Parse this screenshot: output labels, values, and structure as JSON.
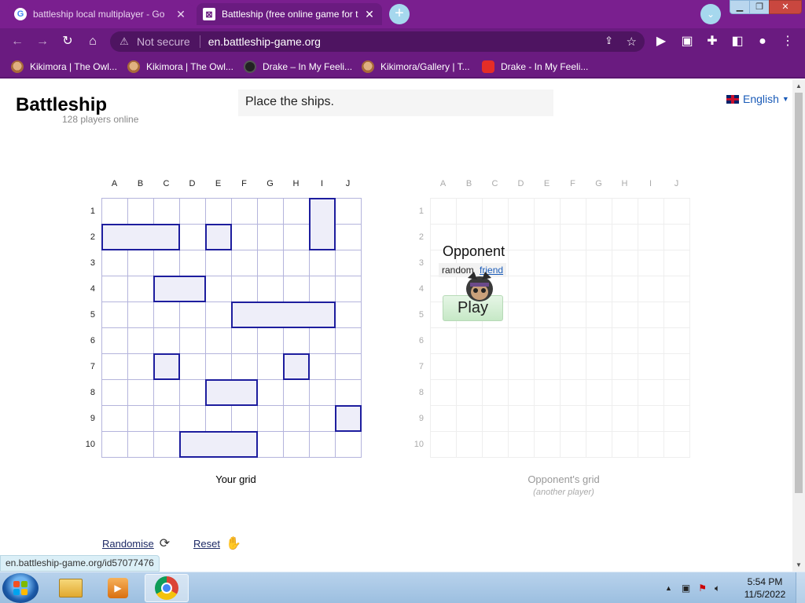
{
  "browser": {
    "tabs": [
      {
        "title": "battleship local multiplayer - Go",
        "favicon": "google-icon",
        "active": false
      },
      {
        "title": "Battleship (free online game for t",
        "favicon": "battleship-icon",
        "active": true
      }
    ],
    "new_tab_symbol": "+",
    "address": {
      "security_text": "Not secure",
      "url": "en.battleship-game.org"
    },
    "bookmarks": [
      {
        "label": "Kikimora | The Owl...",
        "icon": "owl-icon"
      },
      {
        "label": "Kikimora | The Owl...",
        "icon": "owl-icon"
      },
      {
        "label": "Drake – In My Feeli...",
        "icon": "music-icon"
      },
      {
        "label": "Kikimora/Gallery | T...",
        "icon": "owl-icon"
      },
      {
        "label": "Drake - In My Feeli...",
        "icon": "youtube-icon"
      }
    ],
    "status_url": "en.battleship-game.org/id57077476"
  },
  "page": {
    "site_title": "Battleship",
    "players_online": "128 players online",
    "notice": "Place the ships.",
    "language": "English",
    "columns": [
      "A",
      "B",
      "C",
      "D",
      "E",
      "F",
      "G",
      "H",
      "I",
      "J"
    ],
    "rows": [
      "1",
      "2",
      "3",
      "4",
      "5",
      "6",
      "7",
      "8",
      "9",
      "10"
    ],
    "my_grid_caption": "Your grid",
    "opponent_grid_caption": "Opponent's grid",
    "opponent_grid_subcaption": "(another player)",
    "opponent": {
      "title": "Opponent",
      "option_random": "random",
      "option_friend": "friend",
      "play_label": "Play"
    },
    "actions": {
      "randomise": "Randomise",
      "reset": "Reset"
    },
    "ships": [
      {
        "col": 0,
        "row": 1,
        "length": 3,
        "orientation": "horizontal"
      },
      {
        "col": 4,
        "row": 1,
        "length": 1,
        "orientation": "horizontal"
      },
      {
        "col": 8,
        "row": 0,
        "length": 2,
        "orientation": "vertical"
      },
      {
        "col": 2,
        "row": 3,
        "length": 2,
        "orientation": "horizontal"
      },
      {
        "col": 5,
        "row": 4,
        "length": 4,
        "orientation": "horizontal"
      },
      {
        "col": 2,
        "row": 6,
        "length": 1,
        "orientation": "horizontal"
      },
      {
        "col": 7,
        "row": 6,
        "length": 1,
        "orientation": "horizontal"
      },
      {
        "col": 4,
        "row": 7,
        "length": 2,
        "orientation": "horizontal"
      },
      {
        "col": 9,
        "row": 8,
        "length": 1,
        "orientation": "horizontal"
      },
      {
        "col": 3,
        "row": 9,
        "length": 3,
        "orientation": "horizontal"
      }
    ]
  },
  "taskbar": {
    "apps": [
      "windows-explorer",
      "windows-media-player",
      "google-chrome"
    ],
    "time": "5:54 PM",
    "date": "11/5/2022"
  },
  "colors": {
    "chrome_theme": "#6a1b80",
    "ship_border": "#1d1d9e",
    "ship_fill": "#eeeef9",
    "grid_line": "#b4b4dc",
    "link": "#1a5bb8"
  }
}
